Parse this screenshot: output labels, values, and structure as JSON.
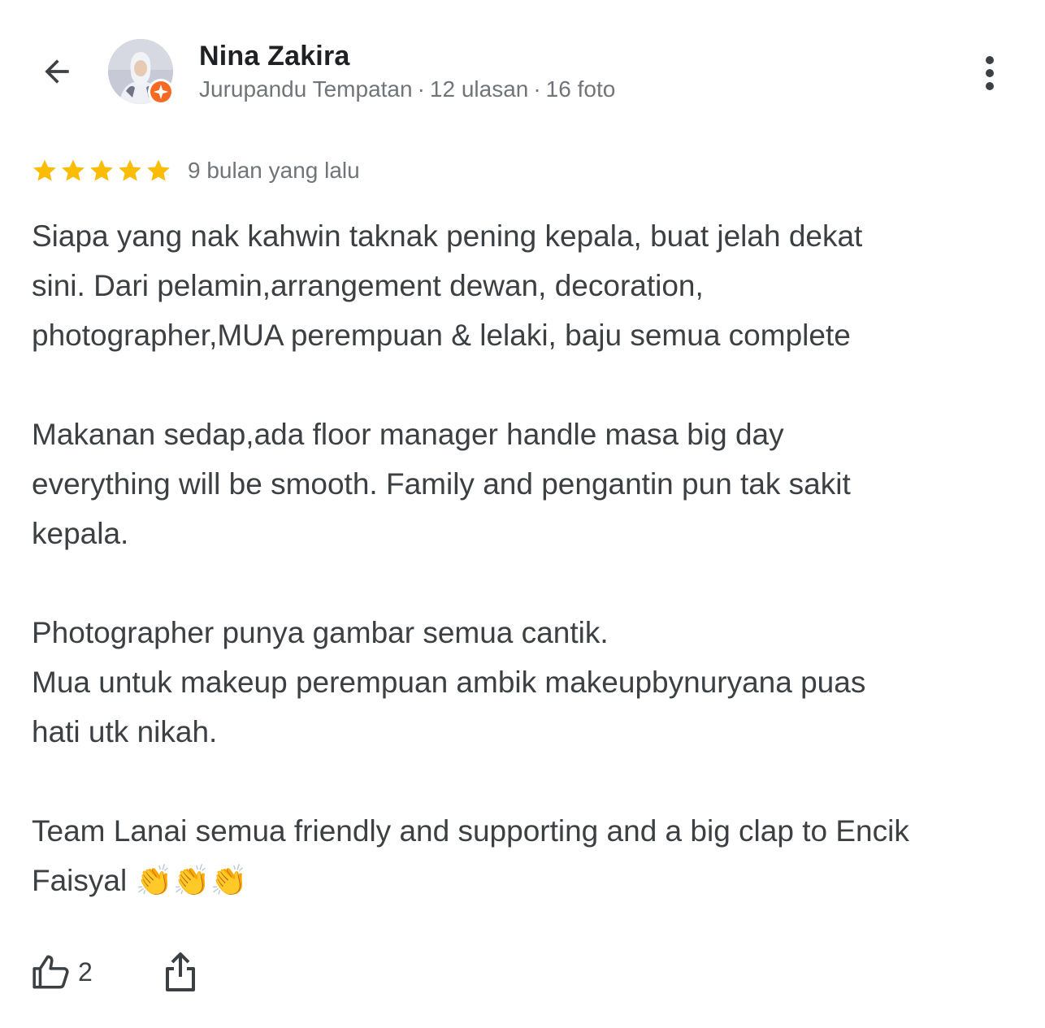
{
  "header": {
    "back_icon": "arrow-left-icon",
    "more_icon": "more-vertical-icon"
  },
  "reviewer": {
    "name": "Nina Zakira",
    "role": "Jurupandu Tempatan",
    "reviews": "12 ulasan",
    "photos": "16 foto",
    "separator": "·",
    "badge_icon": "local-guide-badge-icon",
    "badge_color": "#f46a25"
  },
  "review": {
    "rating": 5,
    "rating_max": 5,
    "star_color": "#fbbc04",
    "time": "9 bulan yang lalu",
    "text": "Siapa yang nak kahwin taknak pening kepala, buat jelah dekat\nsini. Dari pelamin,arrangement dewan, decoration,\nphotographer,MUA perempuan & lelaki, baju semua complete\n\nMakanan sedap,ada floor manager handle masa big day\neverything will be smooth. Family and pengantin pun tak sakit\nkepala.\n\nPhotographer punya gambar semua cantik.\nMua untuk makeup perempuan ambik makeupbynuryana puas\nhati utk nikah.\n\nTeam Lanai semua friendly and supporting and a big clap to Encik\nFaisyal 👏👏👏"
  },
  "actions": {
    "like_icon": "thumbs-up-icon",
    "like_count": "2",
    "share_icon": "share-icon"
  }
}
